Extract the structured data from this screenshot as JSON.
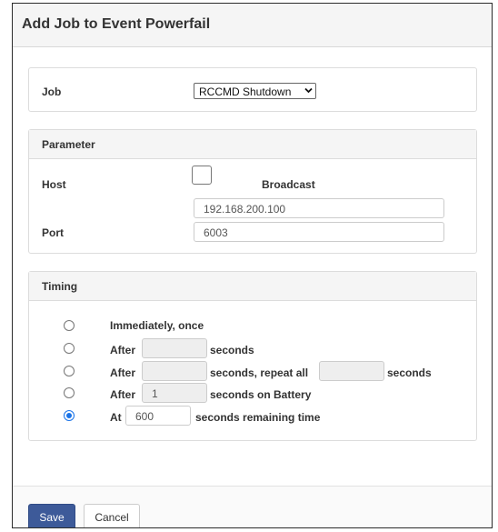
{
  "dialog": {
    "title": "Add Job to Event Powerfail",
    "job_panel": {
      "label": "Job",
      "selected": "RCCMD Shutdown"
    },
    "parameter_panel": {
      "heading": "Parameter",
      "host_label": "Host",
      "broadcast_label": "Broadcast",
      "broadcast_checked": false,
      "host_value": "192.168.200.100",
      "port_label": "Port",
      "port_value": "6003"
    },
    "timing_panel": {
      "heading": "Timing",
      "options": [
        {
          "text": "Immediately, once",
          "checked": false
        },
        {
          "prefix": "After",
          "value": "",
          "suffix": "seconds",
          "checked": false
        },
        {
          "prefix": "After",
          "value": "",
          "middle": "seconds, repeat all",
          "value2": "",
          "suffix": "seconds",
          "checked": false
        },
        {
          "prefix": "After",
          "value": "1",
          "suffix": "seconds on Battery",
          "checked": false
        },
        {
          "prefix": "At",
          "value": "600",
          "suffix": "seconds remaining time",
          "checked": true
        }
      ]
    },
    "footer": {
      "save_label": "Save",
      "cancel_label": "Cancel"
    },
    "colors": {
      "primary_button": "#3d5a99",
      "radio_accent": "#1a73e8"
    }
  }
}
